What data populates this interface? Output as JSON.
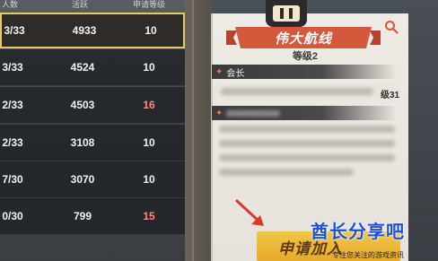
{
  "list": {
    "headers": [
      "人数",
      "活跃",
      "申请等级"
    ],
    "rows": [
      {
        "members": "3/33",
        "activity": "4933",
        "level": "10",
        "selected": true,
        "level_color": "#f2f2f2"
      },
      {
        "members": "3/33",
        "activity": "4524",
        "level": "10",
        "selected": false,
        "level_color": "#f2f2f2"
      },
      {
        "members": "2/33",
        "activity": "4503",
        "level": "16",
        "selected": false,
        "level_color": "#ff8a7a"
      },
      {
        "members": "2/33",
        "activity": "3108",
        "level": "10",
        "selected": false,
        "level_color": "#f2f2f2"
      },
      {
        "members": "7/30",
        "activity": "3070",
        "level": "10",
        "selected": false,
        "level_color": "#f2f2f2"
      },
      {
        "members": "0/30",
        "activity": "799",
        "level": "15",
        "selected": false,
        "level_color": "#ff8a7a"
      }
    ]
  },
  "card": {
    "guild_name": "伟大航线",
    "level_text": "等级2",
    "leader_section": "会长",
    "leader_level": "级31",
    "apply_button": "申请加入"
  },
  "watermark": {
    "title": "酋长分享吧",
    "subtitle": "专注您关注的游戏资讯"
  },
  "icons": {
    "search": "search-icon",
    "emblem": "guild-emblem-icon",
    "arrow": "pointer-arrow-icon"
  },
  "colors": {
    "selected_border": "#e8c86a",
    "ribbon": "#d5573c",
    "button": "#e6a92b",
    "watermark": "#1f4fd6"
  }
}
